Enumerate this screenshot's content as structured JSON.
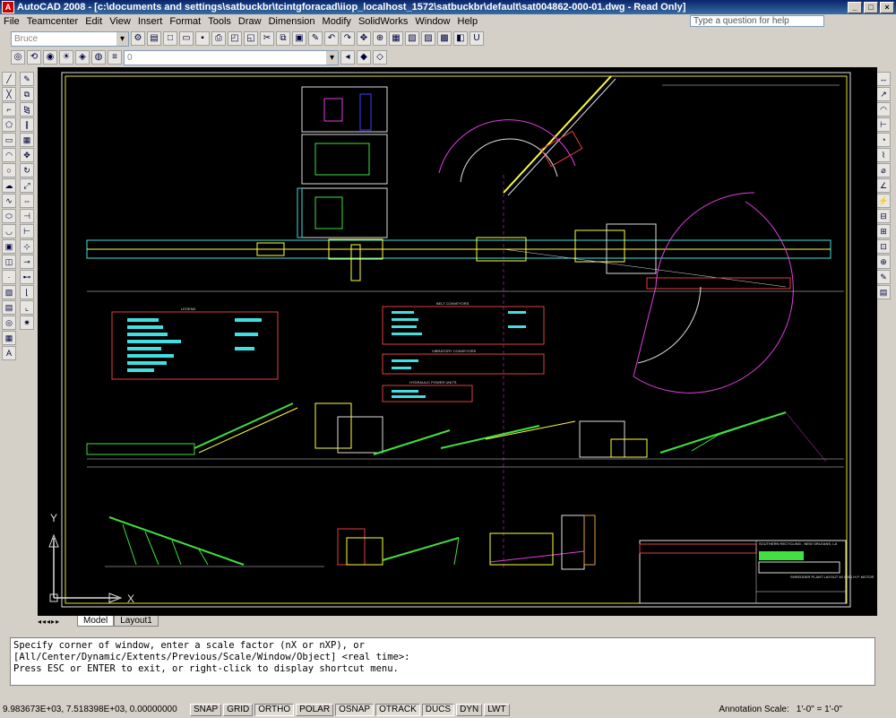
{
  "window": {
    "title": "AutoCAD 2008 - [c:\\documents and settings\\satbuckbr\\tcintgforacad\\iiop_localhost_1572\\satbuckbr\\default\\sat004862-000-01.dwg - Read Only]",
    "help_placeholder": "Type a question for help"
  },
  "menu": [
    "File",
    "Teamcenter",
    "Edit",
    "View",
    "Insert",
    "Format",
    "Tools",
    "Draw",
    "Dimension",
    "Modify",
    "SolidWorks",
    "Window",
    "Help"
  ],
  "toolbar": {
    "user_combo": "Bruce",
    "layer_combo": "0"
  },
  "drawing": {
    "title_block_company": "SOUTHERN RECYCLING - NEW ORLEANS, LA",
    "title_block_title": "SHREDDER PLANT LAYOUT W/ 6000 H.P. MOTOR",
    "legend_title": "LEGEND",
    "belt_title": "BELT CONVEYORS",
    "vib_title": "VIBRATORY CONVEYORS",
    "hyd_title": "HYDRAULIC POWER UNITS",
    "axis_y": "Y",
    "axis_x": "X"
  },
  "tabs": [
    "Model",
    "Layout1"
  ],
  "command_lines": [
    "Specify corner of window, enter a scale factor (nX or nXP), or",
    "[All/Center/Dynamic/Extents/Previous/Scale/Window/Object] <real time>:",
    "Press ESC or ENTER to exit, or right-click to display shortcut menu."
  ],
  "status": {
    "coords": "9.983673E+03, 7.518398E+03, 0.00000000",
    "buttons": [
      "SNAP",
      "GRID",
      "ORTHO",
      "POLAR",
      "OSNAP",
      "OTRACK",
      "DUCS",
      "DYN",
      "LWT"
    ],
    "annotation_scale_label": "Annotation Scale:",
    "annotation_scale_value": "1'-0\" = 1'-0\""
  }
}
